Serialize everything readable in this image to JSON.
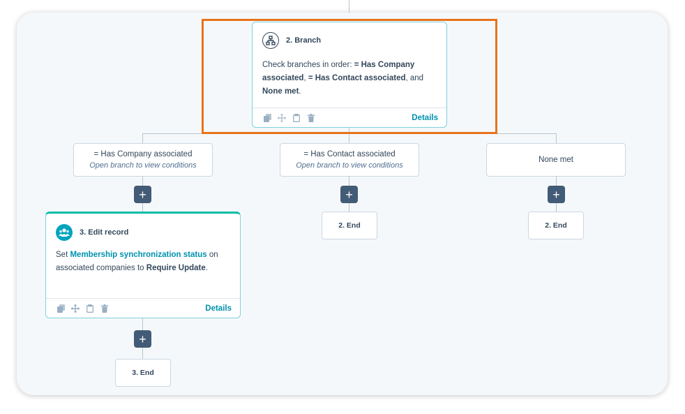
{
  "workflow": {
    "branch_card": {
      "icon": "branch-icon",
      "title": "2. Branch",
      "body_prefix": "Check branches in order: ",
      "branch_1": "= Has Company associated",
      "separator_1": ", ",
      "branch_2": "= Has Contact associated",
      "separator_2": ", and ",
      "branch_3": "None met",
      "body_suffix": ".",
      "details_label": "Details"
    },
    "branches": [
      {
        "name": "= Has Company associated",
        "subtitle": "Open branch to view conditions"
      },
      {
        "name": "= Has Contact associated",
        "subtitle": "Open branch to view conditions"
      },
      {
        "name": "None met"
      }
    ],
    "edit_record_card": {
      "icon": "people-icon",
      "title": "3. Edit record",
      "text_1": "Set ",
      "property": "Membership synchronization status",
      "text_2": " on associated companies to ",
      "value": "Require Update",
      "text_3": ".",
      "details_label": "Details"
    },
    "end_nodes": [
      "2. End",
      "2. End",
      "3. End"
    ],
    "add_button_label": "+",
    "toolbar_icons": [
      "copy-icon",
      "move-icon",
      "clipboard-icon",
      "trash-icon"
    ]
  },
  "colors": {
    "highlight": "#e8731c",
    "link": "#0091ae",
    "accent": "#00a4bd",
    "add_button": "#425b76",
    "text": "#33475b"
  }
}
